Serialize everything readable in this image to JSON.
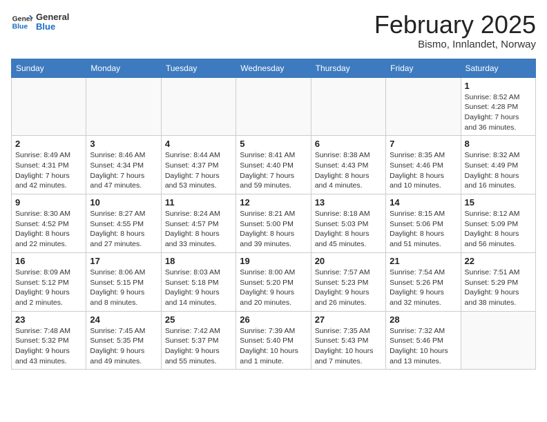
{
  "header": {
    "logo_general": "General",
    "logo_blue": "Blue",
    "month_title": "February 2025",
    "subtitle": "Bismo, Innlandet, Norway"
  },
  "weekdays": [
    "Sunday",
    "Monday",
    "Tuesday",
    "Wednesday",
    "Thursday",
    "Friday",
    "Saturday"
  ],
  "weeks": [
    [
      {
        "day": "",
        "info": ""
      },
      {
        "day": "",
        "info": ""
      },
      {
        "day": "",
        "info": ""
      },
      {
        "day": "",
        "info": ""
      },
      {
        "day": "",
        "info": ""
      },
      {
        "day": "",
        "info": ""
      },
      {
        "day": "1",
        "info": "Sunrise: 8:52 AM\nSunset: 4:28 PM\nDaylight: 7 hours and 36 minutes."
      }
    ],
    [
      {
        "day": "2",
        "info": "Sunrise: 8:49 AM\nSunset: 4:31 PM\nDaylight: 7 hours and 42 minutes."
      },
      {
        "day": "3",
        "info": "Sunrise: 8:46 AM\nSunset: 4:34 PM\nDaylight: 7 hours and 47 minutes."
      },
      {
        "day": "4",
        "info": "Sunrise: 8:44 AM\nSunset: 4:37 PM\nDaylight: 7 hours and 53 minutes."
      },
      {
        "day": "5",
        "info": "Sunrise: 8:41 AM\nSunset: 4:40 PM\nDaylight: 7 hours and 59 minutes."
      },
      {
        "day": "6",
        "info": "Sunrise: 8:38 AM\nSunset: 4:43 PM\nDaylight: 8 hours and 4 minutes."
      },
      {
        "day": "7",
        "info": "Sunrise: 8:35 AM\nSunset: 4:46 PM\nDaylight: 8 hours and 10 minutes."
      },
      {
        "day": "8",
        "info": "Sunrise: 8:32 AM\nSunset: 4:49 PM\nDaylight: 8 hours and 16 minutes."
      }
    ],
    [
      {
        "day": "9",
        "info": "Sunrise: 8:30 AM\nSunset: 4:52 PM\nDaylight: 8 hours and 22 minutes."
      },
      {
        "day": "10",
        "info": "Sunrise: 8:27 AM\nSunset: 4:55 PM\nDaylight: 8 hours and 27 minutes."
      },
      {
        "day": "11",
        "info": "Sunrise: 8:24 AM\nSunset: 4:57 PM\nDaylight: 8 hours and 33 minutes."
      },
      {
        "day": "12",
        "info": "Sunrise: 8:21 AM\nSunset: 5:00 PM\nDaylight: 8 hours and 39 minutes."
      },
      {
        "day": "13",
        "info": "Sunrise: 8:18 AM\nSunset: 5:03 PM\nDaylight: 8 hours and 45 minutes."
      },
      {
        "day": "14",
        "info": "Sunrise: 8:15 AM\nSunset: 5:06 PM\nDaylight: 8 hours and 51 minutes."
      },
      {
        "day": "15",
        "info": "Sunrise: 8:12 AM\nSunset: 5:09 PM\nDaylight: 8 hours and 56 minutes."
      }
    ],
    [
      {
        "day": "16",
        "info": "Sunrise: 8:09 AM\nSunset: 5:12 PM\nDaylight: 9 hours and 2 minutes."
      },
      {
        "day": "17",
        "info": "Sunrise: 8:06 AM\nSunset: 5:15 PM\nDaylight: 9 hours and 8 minutes."
      },
      {
        "day": "18",
        "info": "Sunrise: 8:03 AM\nSunset: 5:18 PM\nDaylight: 9 hours and 14 minutes."
      },
      {
        "day": "19",
        "info": "Sunrise: 8:00 AM\nSunset: 5:20 PM\nDaylight: 9 hours and 20 minutes."
      },
      {
        "day": "20",
        "info": "Sunrise: 7:57 AM\nSunset: 5:23 PM\nDaylight: 9 hours and 26 minutes."
      },
      {
        "day": "21",
        "info": "Sunrise: 7:54 AM\nSunset: 5:26 PM\nDaylight: 9 hours and 32 minutes."
      },
      {
        "day": "22",
        "info": "Sunrise: 7:51 AM\nSunset: 5:29 PM\nDaylight: 9 hours and 38 minutes."
      }
    ],
    [
      {
        "day": "23",
        "info": "Sunrise: 7:48 AM\nSunset: 5:32 PM\nDaylight: 9 hours and 43 minutes."
      },
      {
        "day": "24",
        "info": "Sunrise: 7:45 AM\nSunset: 5:35 PM\nDaylight: 9 hours and 49 minutes."
      },
      {
        "day": "25",
        "info": "Sunrise: 7:42 AM\nSunset: 5:37 PM\nDaylight: 9 hours and 55 minutes."
      },
      {
        "day": "26",
        "info": "Sunrise: 7:39 AM\nSunset: 5:40 PM\nDaylight: 10 hours and 1 minute."
      },
      {
        "day": "27",
        "info": "Sunrise: 7:35 AM\nSunset: 5:43 PM\nDaylight: 10 hours and 7 minutes."
      },
      {
        "day": "28",
        "info": "Sunrise: 7:32 AM\nSunset: 5:46 PM\nDaylight: 10 hours and 13 minutes."
      },
      {
        "day": "",
        "info": ""
      }
    ]
  ]
}
